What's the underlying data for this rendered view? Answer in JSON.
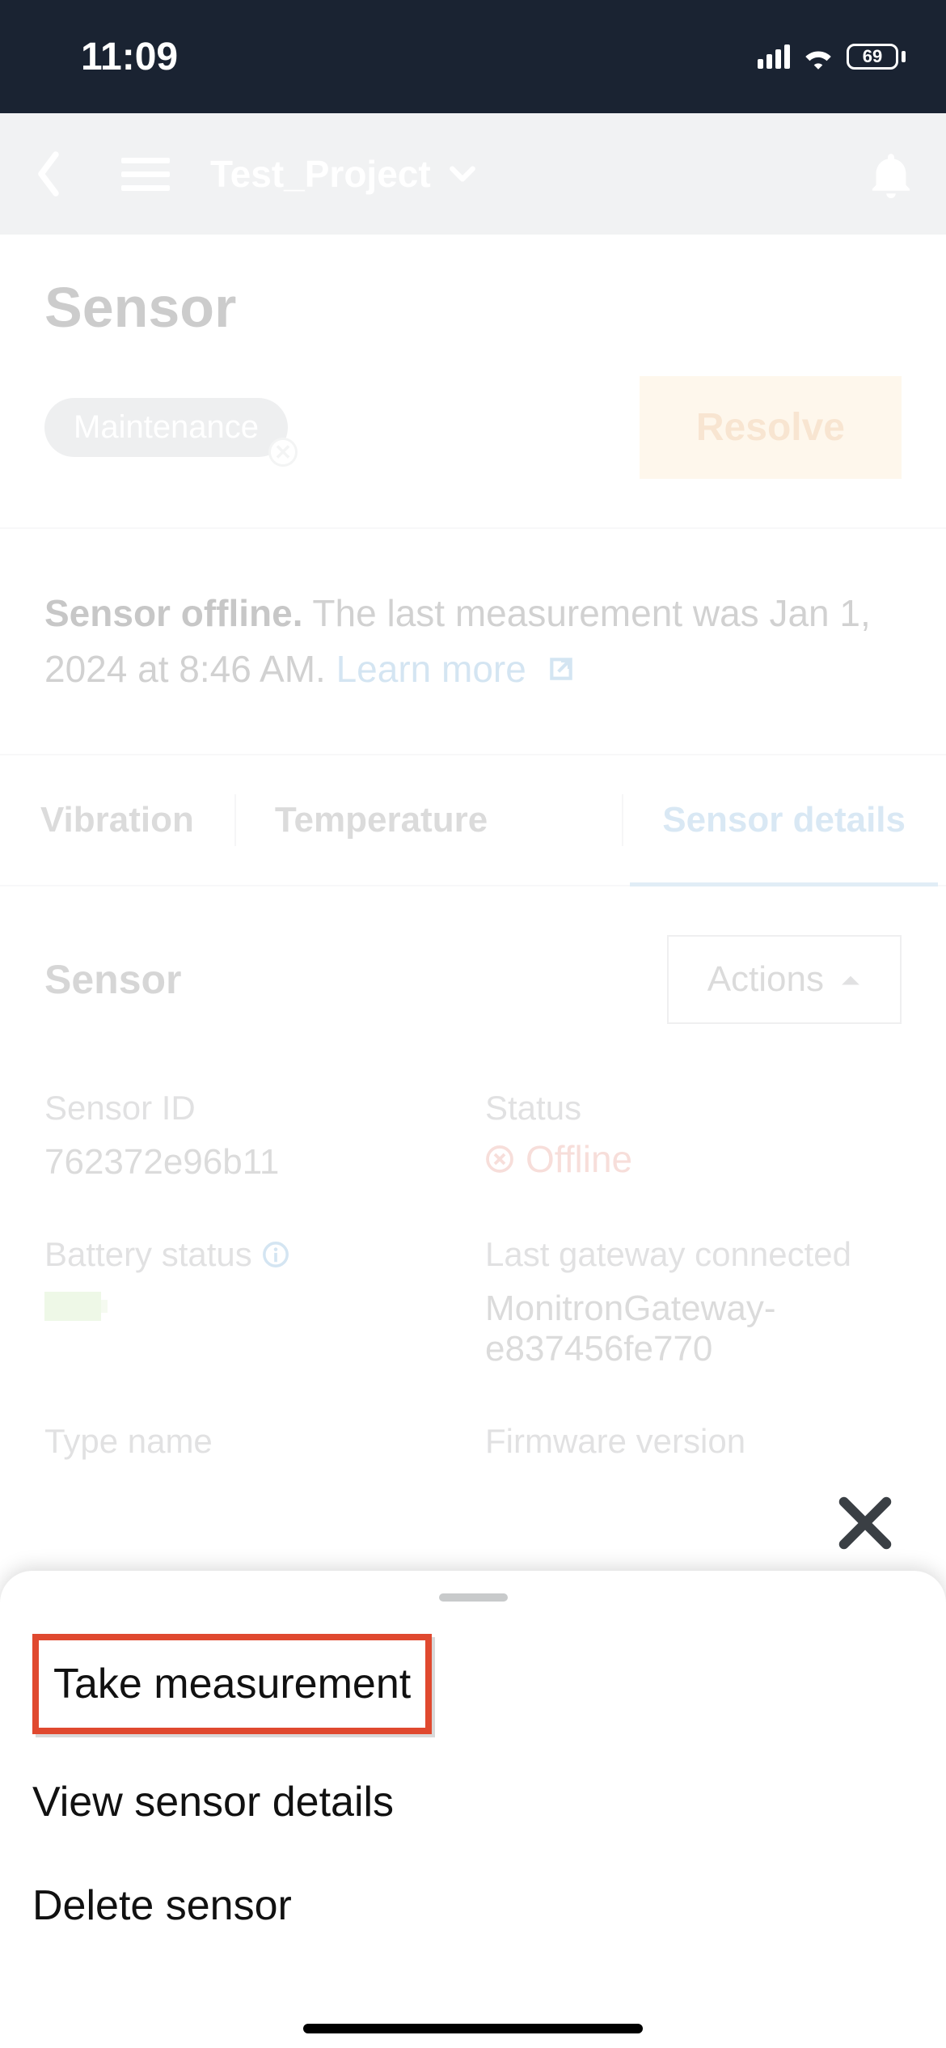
{
  "status": {
    "time": "11:09",
    "battery": "69"
  },
  "header": {
    "project": "Test_Project"
  },
  "page": {
    "title": "Sensor",
    "badge": "Maintenance",
    "resolve": "Resolve"
  },
  "banner": {
    "bold": "Sensor offline.",
    "rest": " The last measurement was Jan 1, 2024 at 8:46 AM. ",
    "link": "Learn more"
  },
  "tabs": {
    "vibration": "Vibration",
    "temperature": "Temperature",
    "details": "Sensor details"
  },
  "details": {
    "heading": "Sensor",
    "actions": "Actions",
    "sensor_id_label": "Sensor ID",
    "sensor_id": "762372e96b11",
    "status_label": "Status",
    "status_value": "Offline",
    "battery_label": "Battery status",
    "gateway_label": "Last gateway connected",
    "gateway_value": "MonitronGateway-e837456fe770",
    "type_label": "Type name",
    "firmware_label": "Firmware version"
  },
  "sheet": {
    "take": "Take measurement",
    "view": "View sensor details",
    "delete": "Delete sensor"
  }
}
